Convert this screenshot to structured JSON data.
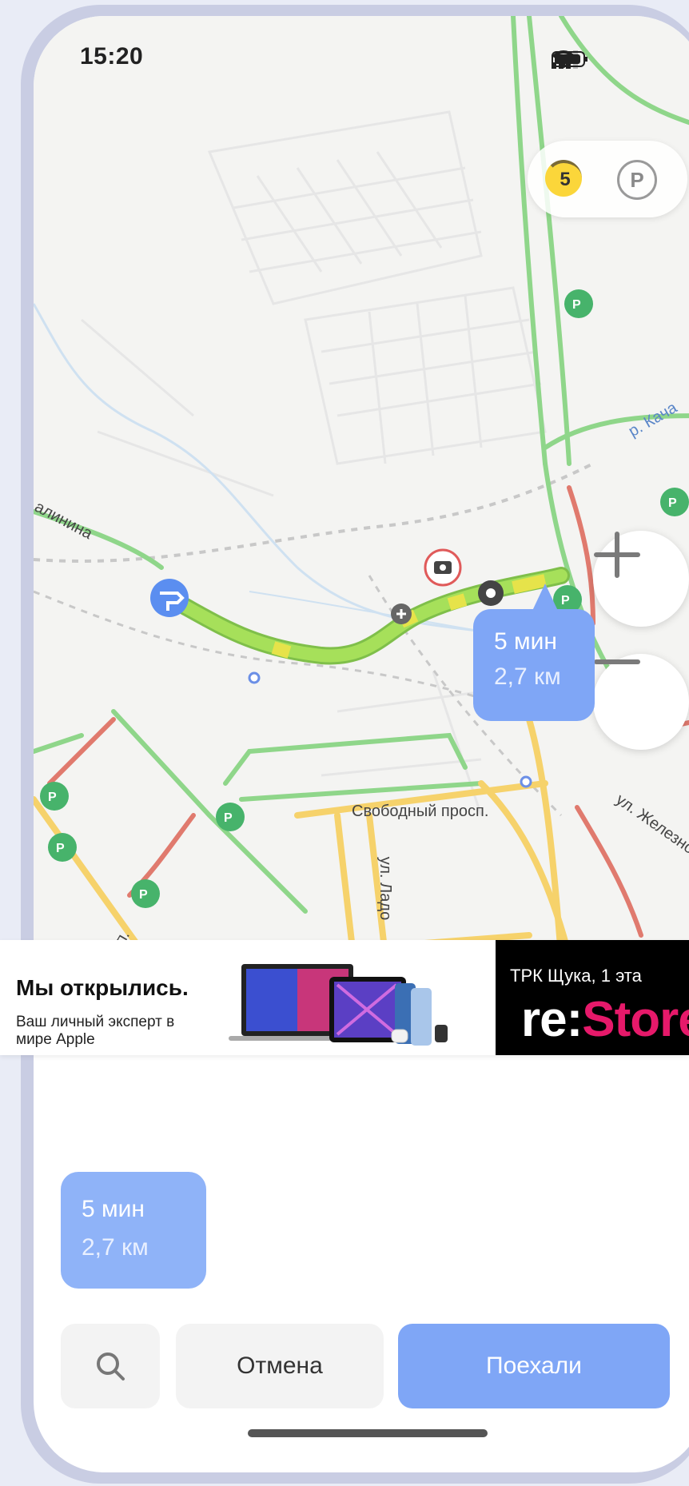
{
  "status_bar": {
    "time": "15:20"
  },
  "map": {
    "traffic_level": "5",
    "parking_label": "P",
    "zoom_in_icon": "plus-icon",
    "zoom_out_icon": "minus-icon",
    "street_labels": {
      "svobodny": "Свободный просп.",
      "lado": "ул. Ладо",
      "zheleznod": "ул. Железно",
      "kacha": "р. Кача",
      "kalinina": "алинина",
      "sp": "сп."
    },
    "route_bubble": {
      "time": "5 мин",
      "distance": "2,7 км"
    }
  },
  "ad": {
    "title": "Мы открылись.",
    "subtitle": "Ваш личный эксперт в мире Apple",
    "store_line": "ТРК Щука, 1 эта",
    "logo_prefix": "re:",
    "logo_brand": "Store"
  },
  "sheet": {
    "route_time": "5 мин",
    "route_distance": "2,7 км",
    "cancel_label": "Отмена",
    "go_label": "Поехали"
  },
  "colors": {
    "accent": "#7fa6f6",
    "route": "#a6e05a",
    "traffic_green": "#8fd68a",
    "traffic_red": "#e07a6e",
    "traffic_yellow": "#f6d26b"
  }
}
